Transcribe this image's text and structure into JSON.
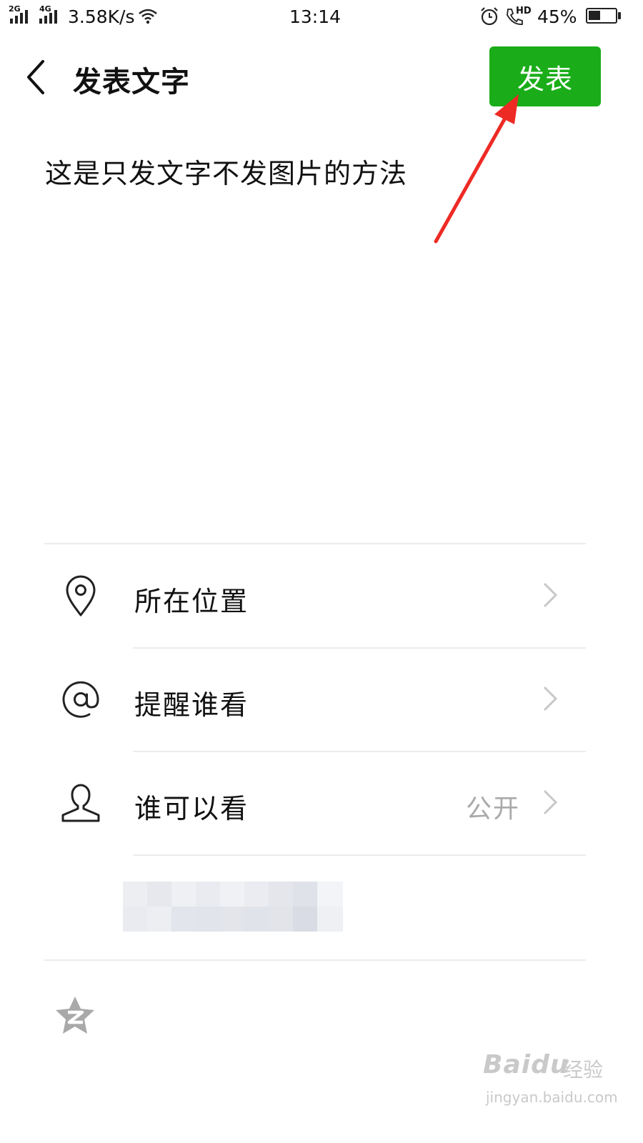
{
  "status_bar": {
    "net1": "2G",
    "net2": "4G",
    "speed": "3.58K/s",
    "time": "13:14",
    "hd": "HD",
    "battery": "45%",
    "battery_level": 0.45
  },
  "header": {
    "title": "发表文字",
    "publish_label": "发表"
  },
  "post": {
    "text": "这是只发文字不发图片的方法"
  },
  "options": [
    {
      "label": "所在位置",
      "icon": "location-pin-icon",
      "value": ""
    },
    {
      "label": "提醒谁看",
      "icon": "at-sign-icon",
      "value": ""
    },
    {
      "label": "谁可以看",
      "icon": "person-icon",
      "value": "公开"
    }
  ],
  "share": {
    "icon": "qzone-star-icon"
  },
  "watermark": {
    "brand": "Baidu",
    "sub": "经验",
    "url": "jingyan.baidu.com"
  },
  "colors": {
    "publish_bg": "#1aad19",
    "annotation_arrow": "#ee2a25"
  }
}
